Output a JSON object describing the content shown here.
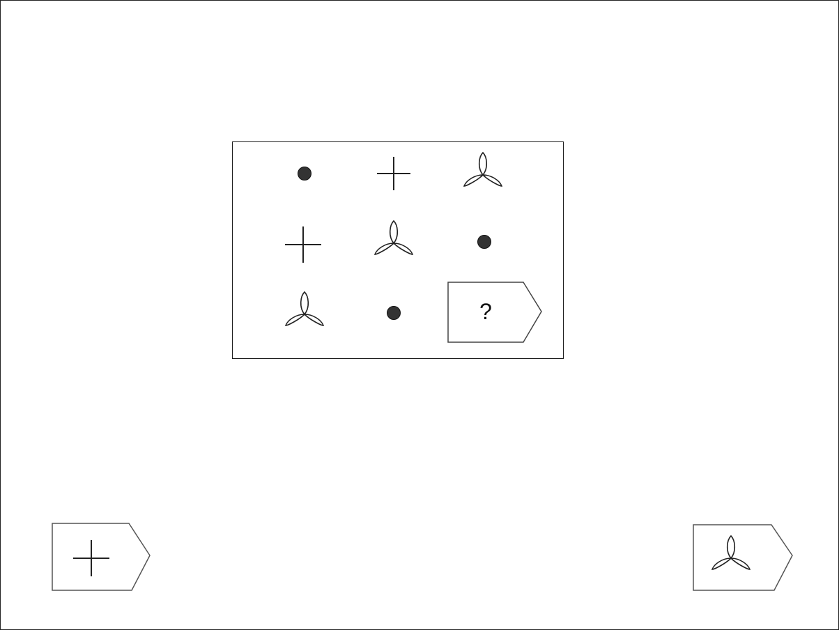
{
  "matrix": {
    "cells": [
      {
        "row": 1,
        "col": 1,
        "symbol": "dot"
      },
      {
        "row": 1,
        "col": 2,
        "symbol": "cross"
      },
      {
        "row": 1,
        "col": 3,
        "symbol": "trefoil"
      },
      {
        "row": 2,
        "col": 1,
        "symbol": "cross"
      },
      {
        "row": 2,
        "col": 2,
        "symbol": "trefoil"
      },
      {
        "row": 2,
        "col": 3,
        "symbol": "dot"
      },
      {
        "row": 3,
        "col": 1,
        "symbol": "trefoil"
      },
      {
        "row": 3,
        "col": 2,
        "symbol": "dot"
      }
    ],
    "missing_cell_label": "?"
  },
  "answers": [
    {
      "id": "left",
      "symbol": "cross"
    },
    {
      "id": "right",
      "symbol": "trefoil"
    }
  ]
}
